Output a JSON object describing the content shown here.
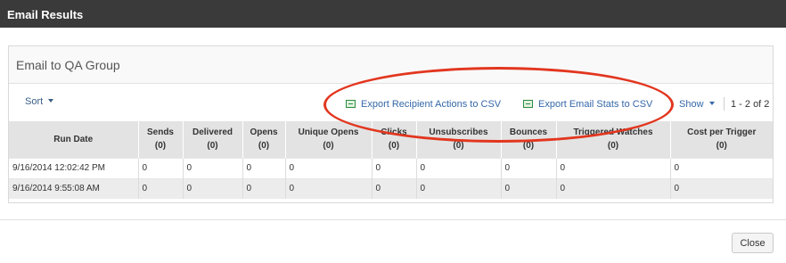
{
  "dialog": {
    "title": "Email Results"
  },
  "panel": {
    "title": "Email to QA Group"
  },
  "toolbar": {
    "sort_label": "Sort",
    "export_recipient_label": "Export Recipient Actions to CSV",
    "export_stats_label": "Export Email Stats to CSV",
    "show_label": "Show",
    "pager_text": "1 - 2 of 2"
  },
  "table": {
    "columns": [
      {
        "name": "Run Date",
        "count": ""
      },
      {
        "name": "Sends",
        "count": "(0)"
      },
      {
        "name": "Delivered",
        "count": "(0)"
      },
      {
        "name": "Opens",
        "count": "(0)"
      },
      {
        "name": "Unique Opens",
        "count": "(0)"
      },
      {
        "name": "Clicks",
        "count": "(0)"
      },
      {
        "name": "Unsubscribes",
        "count": "(0)"
      },
      {
        "name": "Bounces",
        "count": "(0)"
      },
      {
        "name": "Triggered Watches",
        "count": "(0)"
      },
      {
        "name": "Cost per Trigger",
        "count": "(0)"
      }
    ],
    "rows": [
      [
        "9/16/2014 12:02:42 PM",
        "0",
        "0",
        "0",
        "0",
        "0",
        "0",
        "0",
        "0",
        "0"
      ],
      [
        "9/16/2014 9:55:08 AM",
        "0",
        "0",
        "0",
        "0",
        "0",
        "0",
        "0",
        "0",
        "0"
      ]
    ]
  },
  "footer": {
    "close_label": "Close"
  },
  "colors": {
    "highlight_oval": "#e2361f",
    "titlebar": "#3a3a3a",
    "link": "#3468a8"
  },
  "icons": {
    "export": "csv-file-icon",
    "dropdown": "caret-down-icon"
  }
}
